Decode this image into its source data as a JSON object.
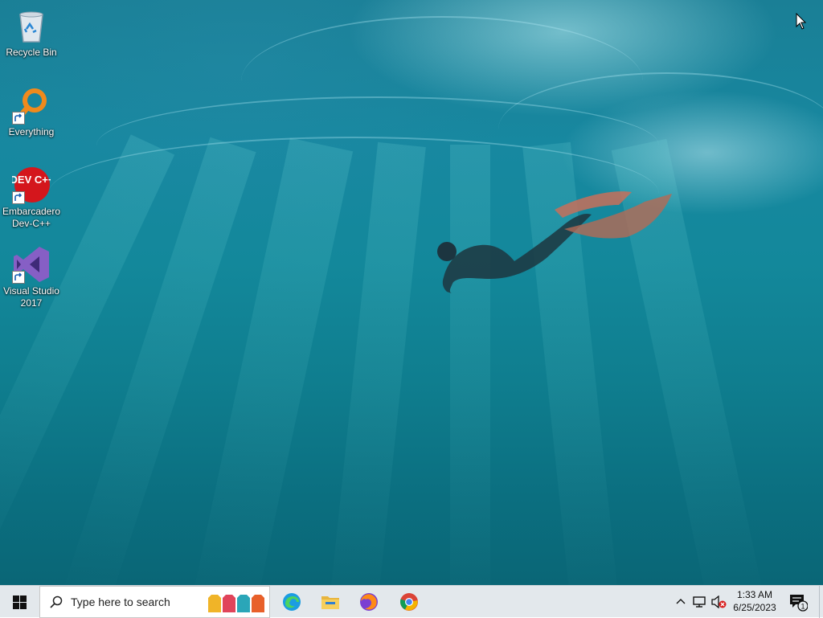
{
  "desktop": {
    "icons": [
      {
        "name": "recycle-bin",
        "label": "Recycle Bin",
        "icon": "recycle-bin-icon"
      },
      {
        "name": "everything",
        "label": "Everything",
        "icon": "magnifier-icon"
      },
      {
        "name": "devcpp",
        "label": "Embarcadero Dev-C++",
        "icon": "devcpp-icon",
        "badge_text": "DEV C++"
      },
      {
        "name": "visual-studio",
        "label": "Visual Studio 2017",
        "icon": "visual-studio-icon"
      }
    ]
  },
  "taskbar": {
    "search_placeholder": "Type here to search",
    "pinned": [
      "edge-icon",
      "file-explorer-icon",
      "firefox-icon",
      "chrome-icon"
    ],
    "clock_time": "1:33 AM",
    "clock_date": "6/25/2023",
    "notification_count": "1"
  },
  "colors": {
    "taskbar_bg": "#e3e8ec",
    "accent": "#0078d7"
  }
}
